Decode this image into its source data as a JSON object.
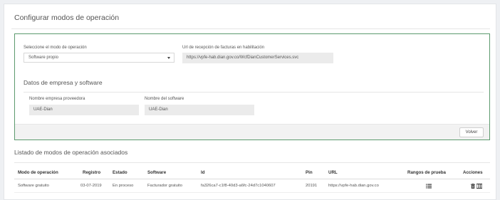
{
  "page": {
    "title": "Configurar modos de operación"
  },
  "config": {
    "mode_label": "Seleccione el modo de operación",
    "mode_value": "Software propio",
    "url_label": "Url de recepción de facturas en habilitación",
    "url_value": "https://vpfe-hab.dian.gov.co/WcfDianCustomerServices.svc",
    "company_section_title": "Datos de empresa y software",
    "provider_label": "Nombre empresa proveedora",
    "provider_value": "UAE-Dian",
    "software_label": "Nombre del software",
    "software_value": "UAE-Dian",
    "back_button": "Volver"
  },
  "list": {
    "title": "Listado de modos de operación asociados",
    "columns": [
      "Modo de operación",
      "Registro",
      "Estado",
      "Software",
      "Id",
      "Pin",
      "URL",
      "Rangos de prueba",
      "Acciones"
    ],
    "rows": [
      {
        "mode": "Software gratuito",
        "registered": "03-07-2019",
        "status": "En proceso",
        "software": "Facturador gratuito",
        "id": "fa326ca7-c1f8-40d3-a6fc-24d7c1040607",
        "pin": "20191",
        "url": "https://vpfe-hab.dian.gov.co",
        "test_ranges_icon": "list-icon",
        "actions_icons": [
          "delete-icon",
          "columns-icon"
        ]
      }
    ]
  },
  "colors": {
    "box_border": "#5c9a6e",
    "field_bg": "#ebebeb",
    "page_bg": "#eef0f3"
  }
}
